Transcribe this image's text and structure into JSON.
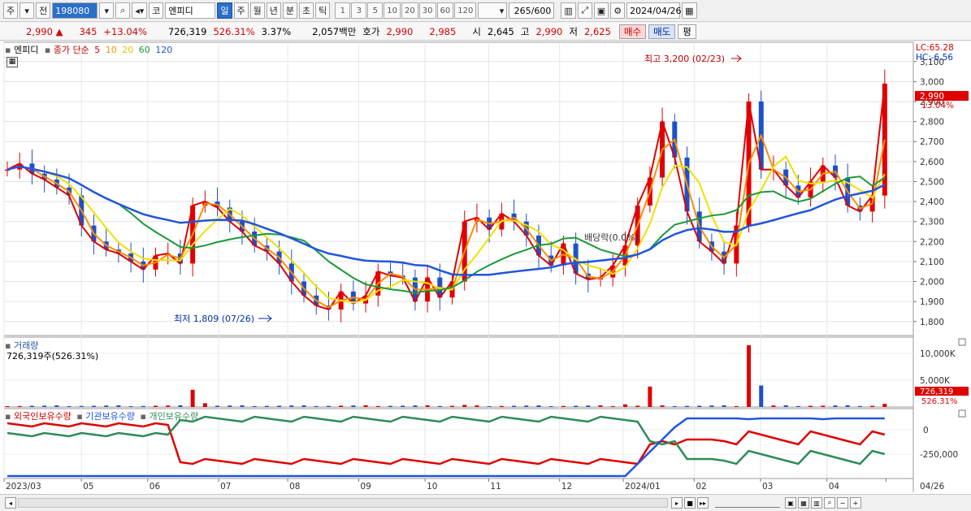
{
  "toolbar": {
    "period_label": "주",
    "prefix_label": "전",
    "code": "198080",
    "market_label": "코",
    "stock_name": "엔피디",
    "tabs": [
      "일",
      "주",
      "월",
      "년",
      "분",
      "초",
      "틱"
    ],
    "active_tab": 0,
    "numbers": [
      "1",
      "3",
      "5",
      "10",
      "20",
      "30",
      "60",
      "120"
    ],
    "count_value": "265",
    "count_total": "/600",
    "date": "2024/04/26"
  },
  "quote": {
    "price": "2,990",
    "change_arrow": "▲",
    "change": "345",
    "change_pct": "+13.04%",
    "volume": "726,319",
    "volume_ratio": "526.31%",
    "turnover": "3.37%",
    "amount": "2,057백만",
    "ask_label": "호가",
    "ask": "2,990",
    "bid": "2,985",
    "open_label": "시",
    "open": "2,645",
    "high_label": "고",
    "high": "2,990",
    "low_label": "저",
    "low": "2,625",
    "buy_label": "매수",
    "sell_label": "매도",
    "avg_label": "평"
  },
  "legend": {
    "name": "엔피디",
    "ma_label": "종가 단순",
    "ma_periods": [
      "5",
      "10",
      "20",
      "60",
      "120"
    ],
    "ma_colors": [
      "#e00000",
      "#ff8c00",
      "#f0e000",
      "#1a9a3a",
      "#2255dd"
    ],
    "vol_title": "거래량",
    "vol_value": "726,319주(526.31%)",
    "inv_items": [
      "외국인보유수량",
      "기관보유수량",
      "개인보유수량"
    ],
    "inv_colors": [
      "#e00000",
      "#2255dd",
      "#2e8b57"
    ]
  },
  "annotations": {
    "high": "최고 3,200 (02/23)",
    "low": "최저 1,809 (07/26)",
    "dividend": "배당락(0.0%)",
    "lc": "LC:65.28",
    "hc": "HC:-6.56",
    "price_tag": "2,990",
    "pct_tag": "13.04%",
    "vol_tag": "726,319",
    "vol_pct_tag": "526.31%"
  },
  "chart_data": {
    "type": "line",
    "title": "엔피디",
    "y_axis_ticks": [
      "3,100",
      "3,000",
      "2,900",
      "2,800",
      "2,700",
      "2,600",
      "2,500",
      "2,400",
      "2,300",
      "2,200",
      "2,100",
      "2,000",
      "1,900",
      "1,800"
    ],
    "ylim": [
      1730,
      3160
    ],
    "x_axis_ticks": [
      "2023/03",
      "05",
      "06",
      "07",
      "08",
      "09",
      "10",
      "11",
      "12",
      "2024/01",
      "02",
      "03",
      "04",
      "04/26"
    ],
    "close_series_approx": [
      2560,
      2590,
      2540,
      2510,
      2470,
      2430,
      2280,
      2200,
      2160,
      2140,
      2100,
      2060,
      2130,
      2140,
      2090,
      2380,
      2400,
      2370,
      2300,
      2250,
      2180,
      2150,
      2090,
      2000,
      1930,
      1880,
      1860,
      1950,
      1890,
      1930,
      2050,
      2030,
      2020,
      1900,
      2020,
      1920,
      2000,
      2300,
      2320,
      2260,
      2340,
      2300,
      2230,
      2130,
      2080,
      2190,
      2040,
      2010,
      2020,
      2080,
      2180,
      2380,
      2520,
      2800,
      2620,
      2350,
      2200,
      2150,
      2090,
      2280,
      2900,
      2560,
      2560,
      2480,
      2420,
      2500,
      2580,
      2520,
      2380,
      2350,
      2430,
      2990
    ],
    "volume_ticks": [
      "10,000K",
      "5,000K"
    ],
    "volume_peak_k": 11500,
    "investor_ticks": [
      "0",
      "-250,000"
    ]
  }
}
